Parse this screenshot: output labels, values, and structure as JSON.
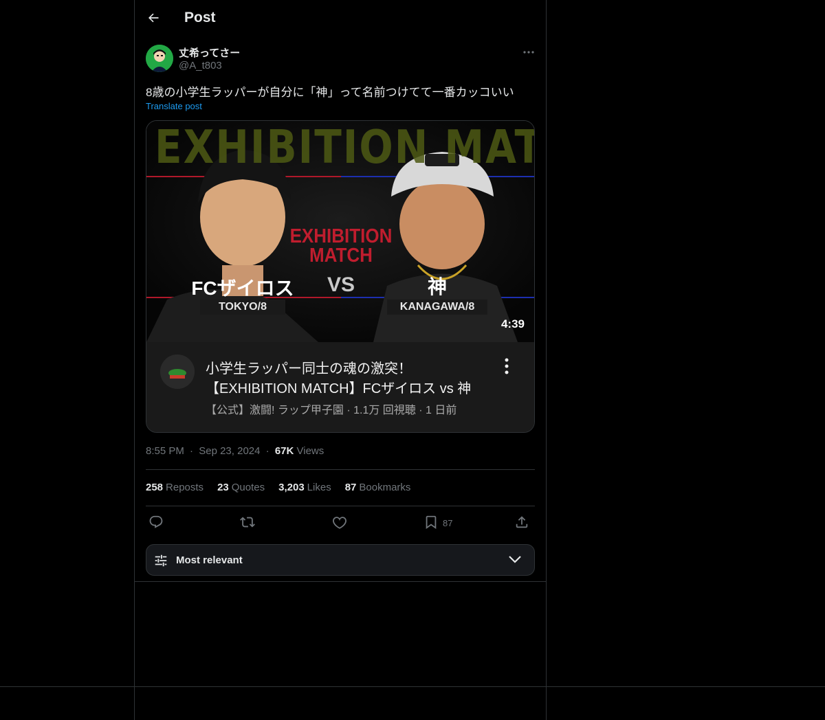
{
  "header": {
    "title": "Post"
  },
  "author": {
    "name": "丈希ってさー",
    "handle": "@A_t803"
  },
  "post": {
    "text": "8歳の小学生ラッパーが自分に「神」って名前つけてて一番カッコいい",
    "translate_label": "Translate post"
  },
  "video": {
    "banner_text": "EXHIBITION MATCH",
    "center_line1": "EXHIBITION",
    "center_line2": "MATCH",
    "left_name": "FCザイロス",
    "left_sub": "TOKYO/8",
    "vs": "VS",
    "right_name": "神",
    "right_sub": "KANAGAWA/8",
    "duration": "4:39",
    "title_line1": "小学生ラッパー同士の魂の激突！",
    "title_line2": "【EXHIBITION MATCH】FCザイロス vs 神",
    "meta": "【公式】激闘! ラップ甲子園 · 1.1万 回視聴 · 1 日前"
  },
  "timestamp": {
    "time": "8:55 PM",
    "dot": "·",
    "date": "Sep 23, 2024",
    "views_count": "67K",
    "views_label": "Views"
  },
  "stats": [
    {
      "count": "258",
      "label": "Reposts"
    },
    {
      "count": "23",
      "label": "Quotes"
    },
    {
      "count": "3,203",
      "label": "Likes"
    },
    {
      "count": "87",
      "label": "Bookmarks"
    }
  ],
  "actions": {
    "bookmark_count": "87"
  },
  "sort": {
    "label": "Most relevant"
  },
  "colors": {
    "accent": "#1d9bf0",
    "muted": "#71767b",
    "text": "#e7e9ea",
    "border": "#2f3336"
  }
}
